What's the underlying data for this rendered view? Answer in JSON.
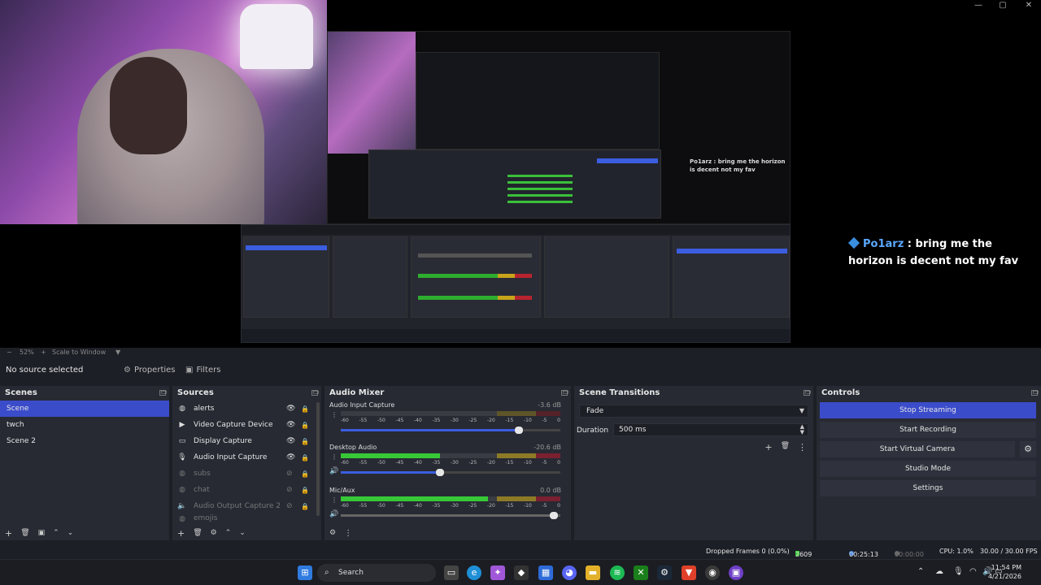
{
  "preview": {
    "window_controls": [
      "—",
      "▢",
      "✕"
    ],
    "inner_chat": {
      "user": "Po1arz",
      "message": "bring me the horizon is decent not my fav"
    },
    "mini_chat_text": "Po1arz : bring me the horizon is decent not my fav"
  },
  "chat_overlay": {
    "user": "Po1arz",
    "separator": " : ",
    "message": "bring me the horizon is decent not my fav"
  },
  "zoom_strip": {
    "minus": "−",
    "zoom": "52%",
    "plus": "+",
    "scale_mode": "Scale to Window",
    "caret": "▼"
  },
  "context_bar": {
    "no_source": "No source selected",
    "properties_label": "Properties",
    "filters_label": "Filters"
  },
  "scenes": {
    "title": "Scenes",
    "items": [
      {
        "label": "Scene",
        "active": true
      },
      {
        "label": "twch",
        "active": false
      },
      {
        "label": "Scene 2",
        "active": false
      }
    ]
  },
  "sources": {
    "title": "Sources",
    "items": [
      {
        "label": "alerts",
        "icon": "browser-icon",
        "visible": true
      },
      {
        "label": "Video Capture Device",
        "icon": "camera-icon",
        "visible": true
      },
      {
        "label": "Display Capture",
        "icon": "monitor-icon",
        "visible": true
      },
      {
        "label": "Audio Input Capture",
        "icon": "mic-icon",
        "visible": true
      },
      {
        "label": "subs",
        "icon": "browser-icon",
        "visible": false
      },
      {
        "label": "chat",
        "icon": "browser-icon",
        "visible": false
      },
      {
        "label": "Audio Output Capture 2",
        "icon": "speaker-icon",
        "visible": false
      },
      {
        "label": "emojis",
        "icon": "browser-icon",
        "visible": false
      }
    ]
  },
  "audio_mixer": {
    "title": "Audio Mixer",
    "scale_ticks": [
      "-60",
      "-55",
      "-50",
      "-45",
      "-40",
      "-35",
      "-30",
      "-25",
      "-20",
      "-15",
      "-10",
      "-5",
      "0"
    ],
    "channels": [
      {
        "name": "Audio Input Capture",
        "db": "-3.6 dB",
        "level": 0.0,
        "volume": 0.81,
        "active": false
      },
      {
        "name": "Desktop Audio",
        "db": "-20.6 dB",
        "level": 0.45,
        "volume": 0.45,
        "active": true
      },
      {
        "name": "Mic/Aux",
        "db": "0.0 dB",
        "level": 0.67,
        "volume": 0.97,
        "active": true
      }
    ]
  },
  "scene_transitions": {
    "title": "Scene Transitions",
    "transition": "Fade",
    "duration_label": "Duration",
    "duration_value": "500 ms"
  },
  "controls": {
    "title": "Controls",
    "buttons": [
      "Stop Streaming",
      "Start Recording",
      "Start Virtual Camera",
      "Studio Mode",
      "Settings"
    ]
  },
  "status_bar": {
    "dropped_frames": "Dropped Frames 0 (0.0%)",
    "bitrate": "2609 kbps",
    "stream_time": "00:25:13",
    "rec_time": "00:00:00",
    "cpu": "CPU: 1.0%",
    "fps": "30.00 / 30.00 FPS"
  },
  "taskbar": {
    "search_placeholder": "Search",
    "clock_time": "11:54 PM",
    "clock_date": "4/21/2026"
  },
  "colors": {
    "accent": "#3b4ccb",
    "panel": "#272a33",
    "background": "#1d1f26",
    "meter_green": "#37c837"
  }
}
